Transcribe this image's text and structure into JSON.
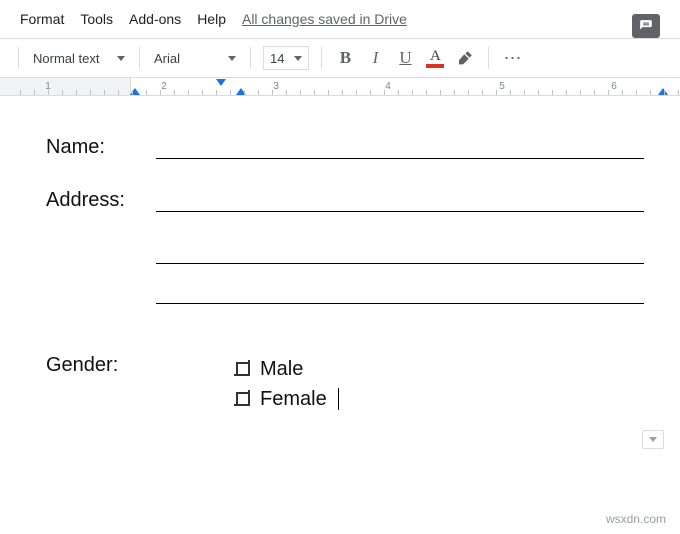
{
  "menu": {
    "format": "Format",
    "tools": "Tools",
    "addons": "Add-ons",
    "help": "Help",
    "status": "All changes saved in Drive"
  },
  "toolbar": {
    "styleLabel": "Normal text",
    "fontLabel": "Arial",
    "fontSize": "14",
    "boldLetter": "B",
    "italicLetter": "I",
    "underlineLetter": "U",
    "textColorLetter": "A",
    "textColorSwatch": "#d93025"
  },
  "ruler": {
    "numbers": [
      "1",
      "2",
      "3",
      "4",
      "5",
      "6"
    ]
  },
  "form": {
    "nameLabel": "Name:",
    "addressLabel": "Address:",
    "genderLabel": "Gender:",
    "options": {
      "male": "Male",
      "female": "Female"
    }
  },
  "watermark": "wsxdn.com"
}
